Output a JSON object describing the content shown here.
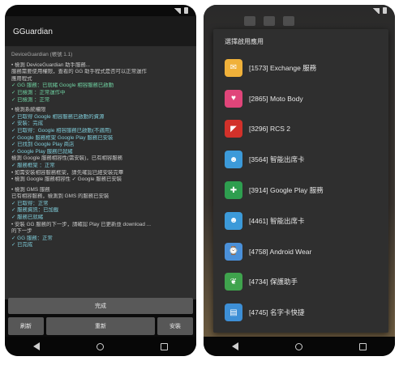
{
  "left": {
    "app_title": "GGuardian",
    "log_lines": [
      {
        "t": "DeviceGuardian (帳號 1.1)",
        "c": "dim"
      },
      {
        "t": "",
        "c": "gap"
      },
      {
        "t": "• 檢測 DeviceGuardian 助手服務...",
        "c": ""
      },
      {
        "t": "  服務需要使用權限，查看的 GG 助手程式是否可以正常運作",
        "c": ""
      },
      {
        "t": "  應用程式",
        "c": ""
      },
      {
        "t": "  ✓ GG 服務：已就緒 Google 相容服務已啟動",
        "c": "ok"
      },
      {
        "t": "  ✓ 已檢測 ：正常運作中",
        "c": "ok"
      },
      {
        "t": "  ✓ 已檢測 ：正常",
        "c": "ok"
      },
      {
        "t": "",
        "c": "gap"
      },
      {
        "t": "• 檢測系統權限",
        "c": ""
      },
      {
        "t": "  ✓ 已取得 Google 相容服務已啟動的資源",
        "c": "ok2"
      },
      {
        "t": "  ✓ 安裝：完成",
        "c": "ok2"
      },
      {
        "t": "  ✓ 已取得：Google 相容服務已啟動(不適用)",
        "c": "ok2"
      },
      {
        "t": "  ✓ Google 服務框架 Google Play 服務已安裝",
        "c": "ok2"
      },
      {
        "t": "    ✓ 已找到 Google Play 商店",
        "c": "ok2"
      },
      {
        "t": "    ✓ Google Play 服務已就緒",
        "c": "ok2"
      },
      {
        "t": "  檢測 Google 服務相容性(需安裝)，已有相容服務",
        "c": ""
      },
      {
        "t": "    ✓ 服務框架 ：正常",
        "c": "ok2"
      },
      {
        "t": "  • 如需安裝相容服務框架，請先確認已經安裝完畢",
        "c": ""
      },
      {
        "t": "  • 檢測 Google 服務相容性  ✓ Google 服務已安裝",
        "c": ""
      },
      {
        "t": "",
        "c": "gap"
      },
      {
        "t": "  • 檢測 GMS 服務",
        "c": ""
      },
      {
        "t": "    已有相容服務，檢測到 GMS 的服務已安裝",
        "c": ""
      },
      {
        "t": "  ✓ 已取得：正常",
        "c": "ok2"
      },
      {
        "t": "    ✓ 服務資訊：已加載",
        "c": "ok2"
      },
      {
        "t": "    ✓ 服務已就緒",
        "c": "ok2"
      },
      {
        "t": "  • 安裝 GG 服務的下一步，請確認 Play 已更新並 download ...",
        "c": ""
      },
      {
        "t": "  的下一步",
        "c": ""
      },
      {
        "t": "    ✓ GG 服務：正常",
        "c": "ok2"
      },
      {
        "t": "    ✓ 已完成",
        "c": "ok2"
      }
    ],
    "btn_main": "完成",
    "btn_left": "刷新",
    "btn_mid": "重新",
    "btn_right": "安裝"
  },
  "right": {
    "dialog_title": "選擇啟用應用",
    "apps": [
      {
        "label": "[1573] Exchange 服務",
        "icon": "exchange-icon",
        "color": "#f0b13a",
        "glyph": "✉"
      },
      {
        "label": "[2865] Moto Body",
        "icon": "heart-icon",
        "color": "#e0457a",
        "glyph": "♥"
      },
      {
        "label": "[3296] RCS 2",
        "icon": "rcs-icon",
        "color": "#d2312a",
        "glyph": "◤"
      },
      {
        "label": "[3564] 智能出席卡",
        "icon": "robot-icon",
        "color": "#3c9ad9",
        "glyph": "☻"
      },
      {
        "label": "[3914] Google Play 服務",
        "icon": "puzzle-icon",
        "color": "#2e9e4f",
        "glyph": "✚"
      },
      {
        "label": "[4461] 智能出席卡",
        "icon": "robot-icon",
        "color": "#3c9ad9",
        "glyph": "☻"
      },
      {
        "label": "[4758] Android Wear",
        "icon": "watch-icon",
        "color": "#4a90d9",
        "glyph": "⌚"
      },
      {
        "label": "[4734] 保護助手",
        "icon": "leaf-icon",
        "color": "#3fa34d",
        "glyph": "❦"
      },
      {
        "label": "[4745] 名字卡快捷",
        "icon": "card-icon",
        "color": "#3d8fd6",
        "glyph": "▤"
      }
    ]
  }
}
